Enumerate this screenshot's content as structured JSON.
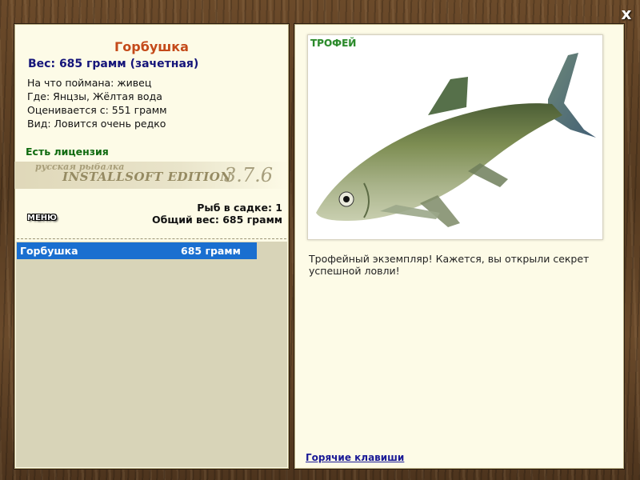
{
  "close_label": "x",
  "fish": {
    "name": "Горбушка",
    "weight_line": "Вес: 685 грамм (зачетная)",
    "caught_with": "На что поймана: живец",
    "location": "Где: Янцзы, Жёлтая вода",
    "rated_from": "Оценивается с: 551 грамм",
    "kind": "Вид: Ловится очень редко"
  },
  "license": "Есть лицензия",
  "watermark": {
    "line1": "русская рыбалка",
    "line2": "INSTALLSOFT EDITION",
    "version": "3.7.6"
  },
  "cage": {
    "count_line": "Рыб в садке: 1",
    "total_line": "Общий вес: 685 грамм"
  },
  "menu_label": "МЕНЮ",
  "fish_list": [
    {
      "name": "Горбушка",
      "weight": "685 грамм"
    }
  ],
  "trophy_label": "ТРОФЕЙ",
  "description": "Трофейный экземпляр! Кажется, вы открыли секрет успешной ловли!",
  "hotkeys_label": "Горячие клавиши",
  "colors": {
    "title": "#c44a1a",
    "weight": "#15157a",
    "license": "#0f6a0f",
    "selection": "#1a6fd0",
    "trophy": "#2c8a2c"
  },
  "icons": {
    "close": "close-icon",
    "fish_image": "fish-image"
  }
}
